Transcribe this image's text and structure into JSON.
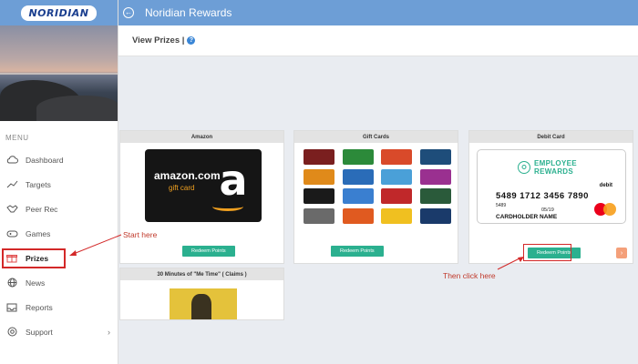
{
  "logo": {
    "text": "NORIDIAN"
  },
  "header": {
    "back_icon": "circle-arrow-left-icon",
    "title": "Noridian Rewards"
  },
  "subheader": {
    "text": "View Prizes |",
    "help_icon": "?"
  },
  "sidebar": {
    "menu_label": "MENU",
    "items": [
      {
        "label": "Dashboard",
        "icon": "cloud-icon",
        "active": false
      },
      {
        "label": "Targets",
        "icon": "trend-icon",
        "active": false
      },
      {
        "label": "Peer Rec",
        "icon": "handshake-icon",
        "active": false
      },
      {
        "label": "Games",
        "icon": "gamepad-icon",
        "active": false
      },
      {
        "label": "Prizes",
        "icon": "gift-icon",
        "active": true
      },
      {
        "label": "News",
        "icon": "globe-icon",
        "active": false
      },
      {
        "label": "Reports",
        "icon": "inbox-icon",
        "active": false
      },
      {
        "label": "Support",
        "icon": "help-circle-icon",
        "active": false,
        "chevron": "›"
      }
    ]
  },
  "prizes": [
    {
      "title": "Amazon",
      "redeem_label": "Redeem Points"
    },
    {
      "title": "Gift Cards",
      "redeem_label": "Redeem Points"
    },
    {
      "title": "Debit Card",
      "redeem_label": "Redeem Points"
    },
    {
      "title": "30 Minutes of \"Me Time\" ( Claims )"
    }
  ],
  "amazon_art": {
    "word": "amazon.com",
    "sub": "gift card",
    "letter": "a"
  },
  "debit_art": {
    "brand_line1": "EMPLOYEE",
    "brand_line2": "REWARDS",
    "debit": "debit",
    "number": "5489 1712 3456 7890",
    "small": "5489",
    "exp": "05/19",
    "holder": "CARDHOLDER NAME"
  },
  "gift_card_colors": [
    "#7a1f1f",
    "#2c8a3a",
    "#d94a2a",
    "#1e4d7a",
    "#e08a1a",
    "#2a6cb8",
    "#4aa0d8",
    "#9a3090",
    "#1a1a1a",
    "#3a7fd0",
    "#c0282a",
    "#2a5a3a",
    "#6a6a6a",
    "#e05a20",
    "#f0c020",
    "#1a3a6a"
  ],
  "scroll_tab": {
    "text": "›",
    "color": "#f4a07a"
  },
  "annotations": {
    "start": "Start here",
    "then": "Then click here"
  },
  "colors": {
    "header": "#6d9ed6",
    "accent_green": "#2bb08f",
    "highlight_red": "#d32828"
  }
}
